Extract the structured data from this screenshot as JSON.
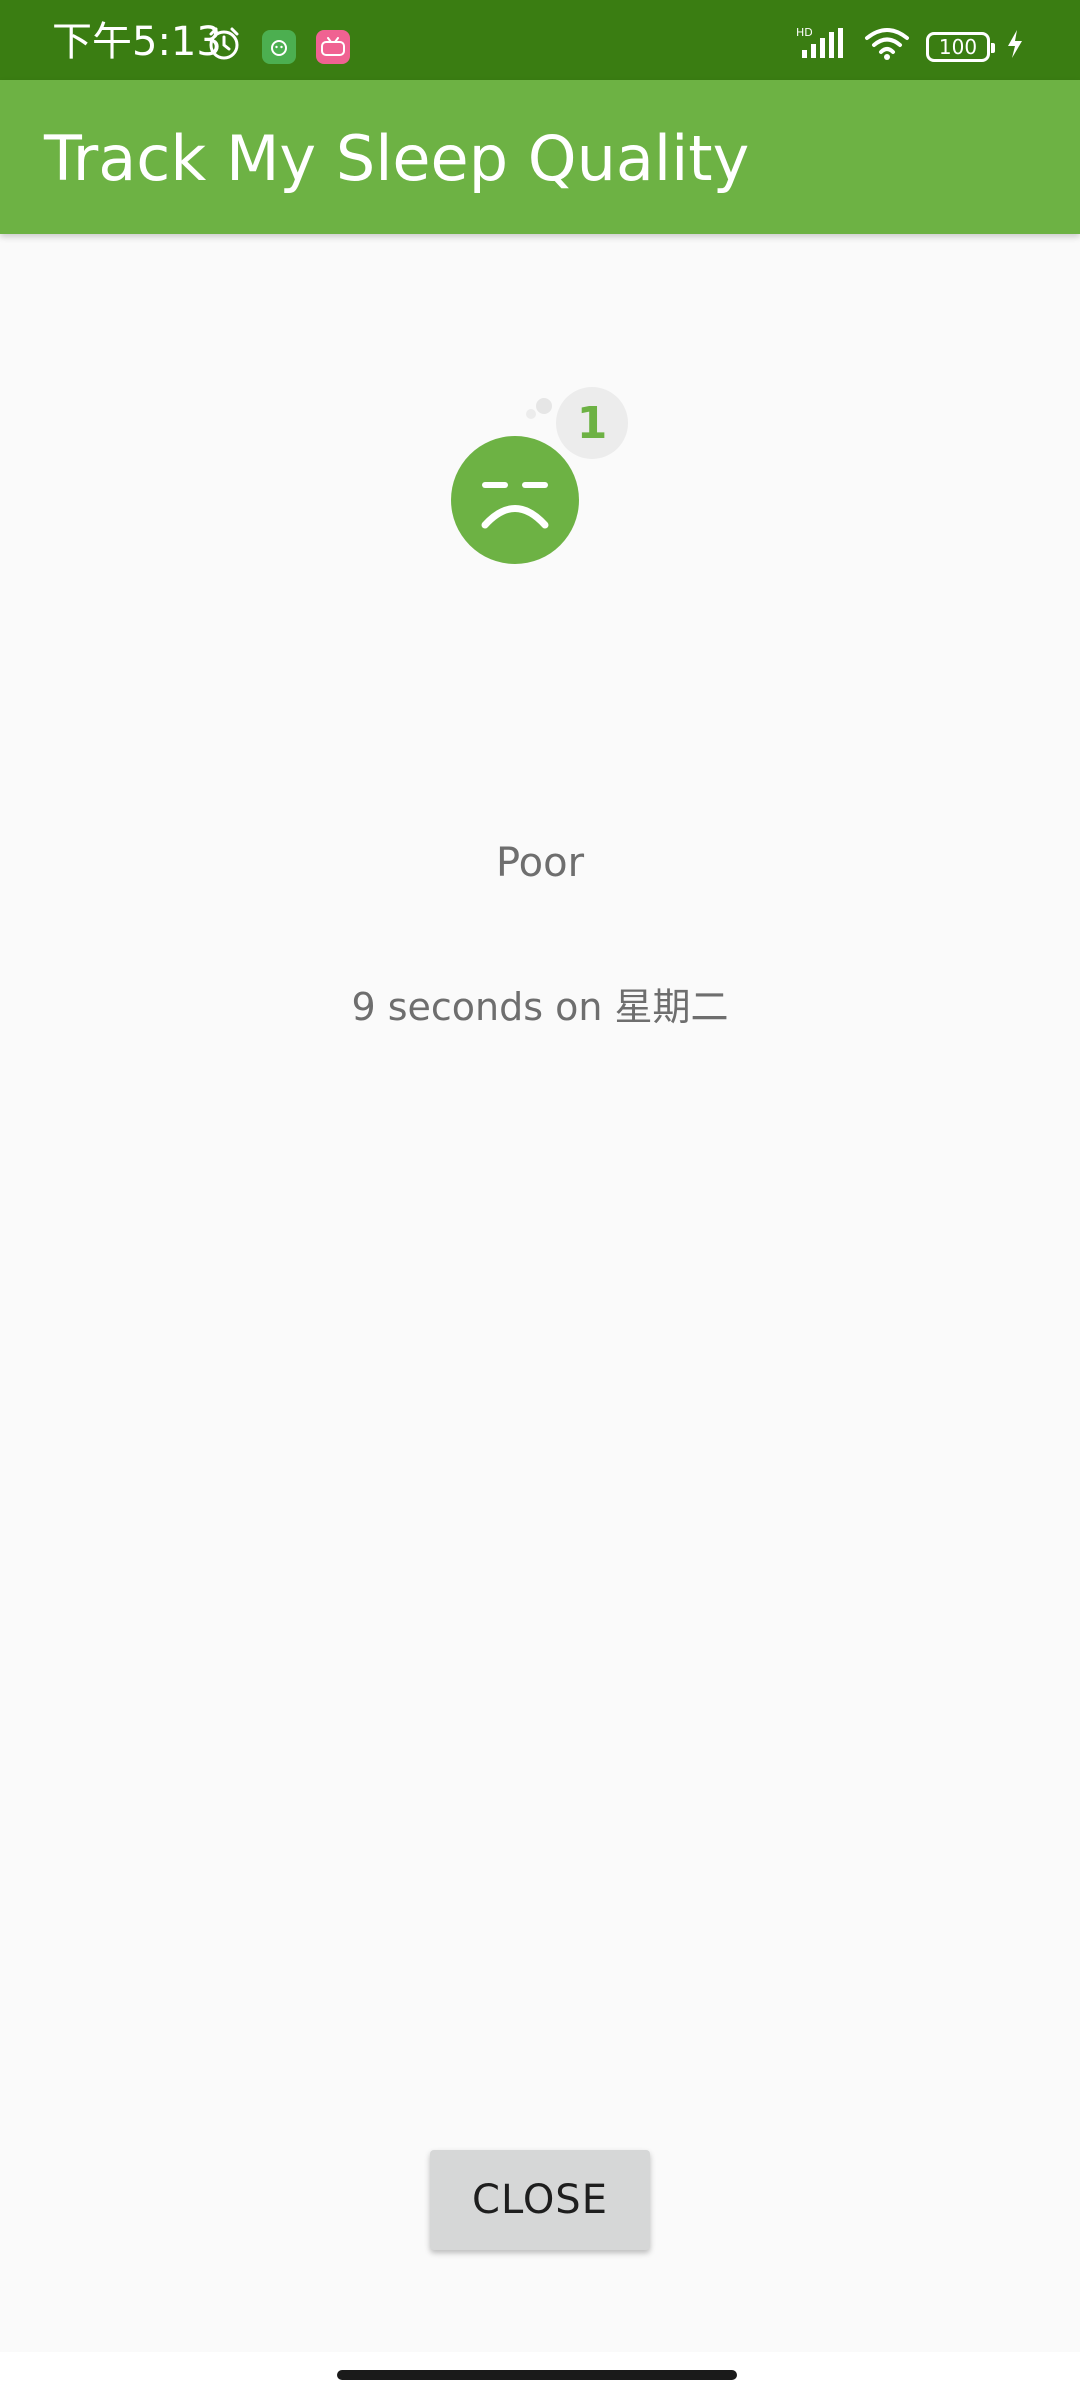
{
  "status_bar": {
    "time": "下午5:13",
    "battery_level": "100",
    "network_label": "HD",
    "icons": [
      "alarm-icon",
      "app-notification-icon",
      "bilibili-icon",
      "signal-icon",
      "wifi-icon",
      "battery-icon",
      "charging-icon"
    ],
    "colors": {
      "background": "#3a7d12"
    }
  },
  "app_bar": {
    "title": "Track My Sleep Quality",
    "colors": {
      "background": "#6db244",
      "text": "#ffffff"
    }
  },
  "sleep_detail": {
    "quality_icon": "sad-face-icon",
    "quality_badge_number": "1",
    "quality_label": "Poor",
    "sleep_length": "9 seconds on 星期二",
    "colors": {
      "icon": "#6db244",
      "text": "#6e6e6e"
    }
  },
  "actions": {
    "close_label": "CLOSE"
  }
}
